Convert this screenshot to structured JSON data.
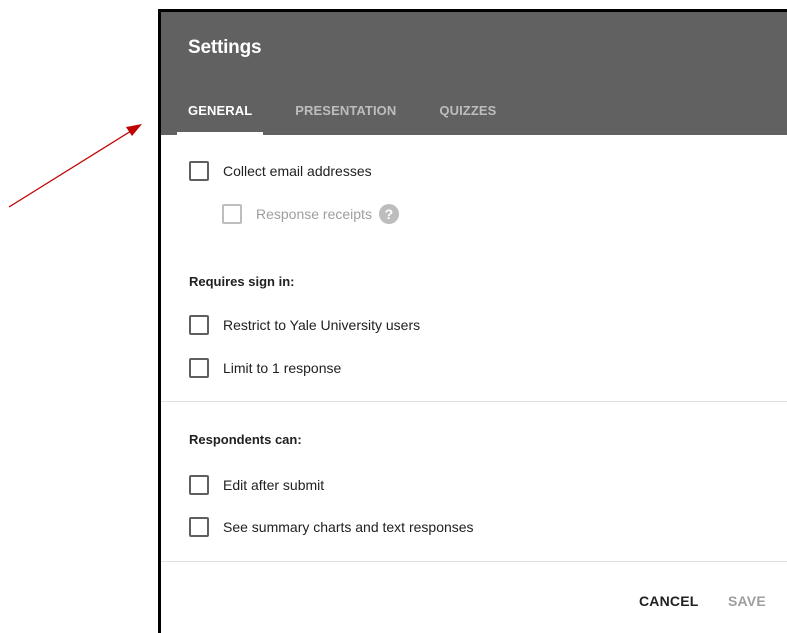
{
  "dialog": {
    "title": "Settings",
    "tabs": [
      {
        "label": "GENERAL",
        "active": true
      },
      {
        "label": "PRESENTATION",
        "active": false
      },
      {
        "label": "QUIZZES",
        "active": false
      }
    ]
  },
  "general": {
    "collect_email": {
      "label": "Collect email addresses",
      "checked": false
    },
    "response_receipts": {
      "label": "Response receipts",
      "checked": false,
      "disabled": true,
      "icon": "help-icon"
    },
    "requires_sign_in": {
      "heading": "Requires sign in:",
      "restrict": {
        "label": "Restrict to Yale University users",
        "checked": false
      },
      "limit": {
        "label": "Limit to 1 response",
        "checked": false
      }
    },
    "respondents_can": {
      "heading": "Respondents can:",
      "edit": {
        "label": "Edit after submit",
        "checked": false
      },
      "summary": {
        "label": "See summary charts and text responses",
        "checked": false
      }
    }
  },
  "footer": {
    "cancel_label": "CANCEL",
    "save_label": "SAVE"
  },
  "colors": {
    "header": "#616161",
    "annotation_arrow": "#c00000"
  }
}
